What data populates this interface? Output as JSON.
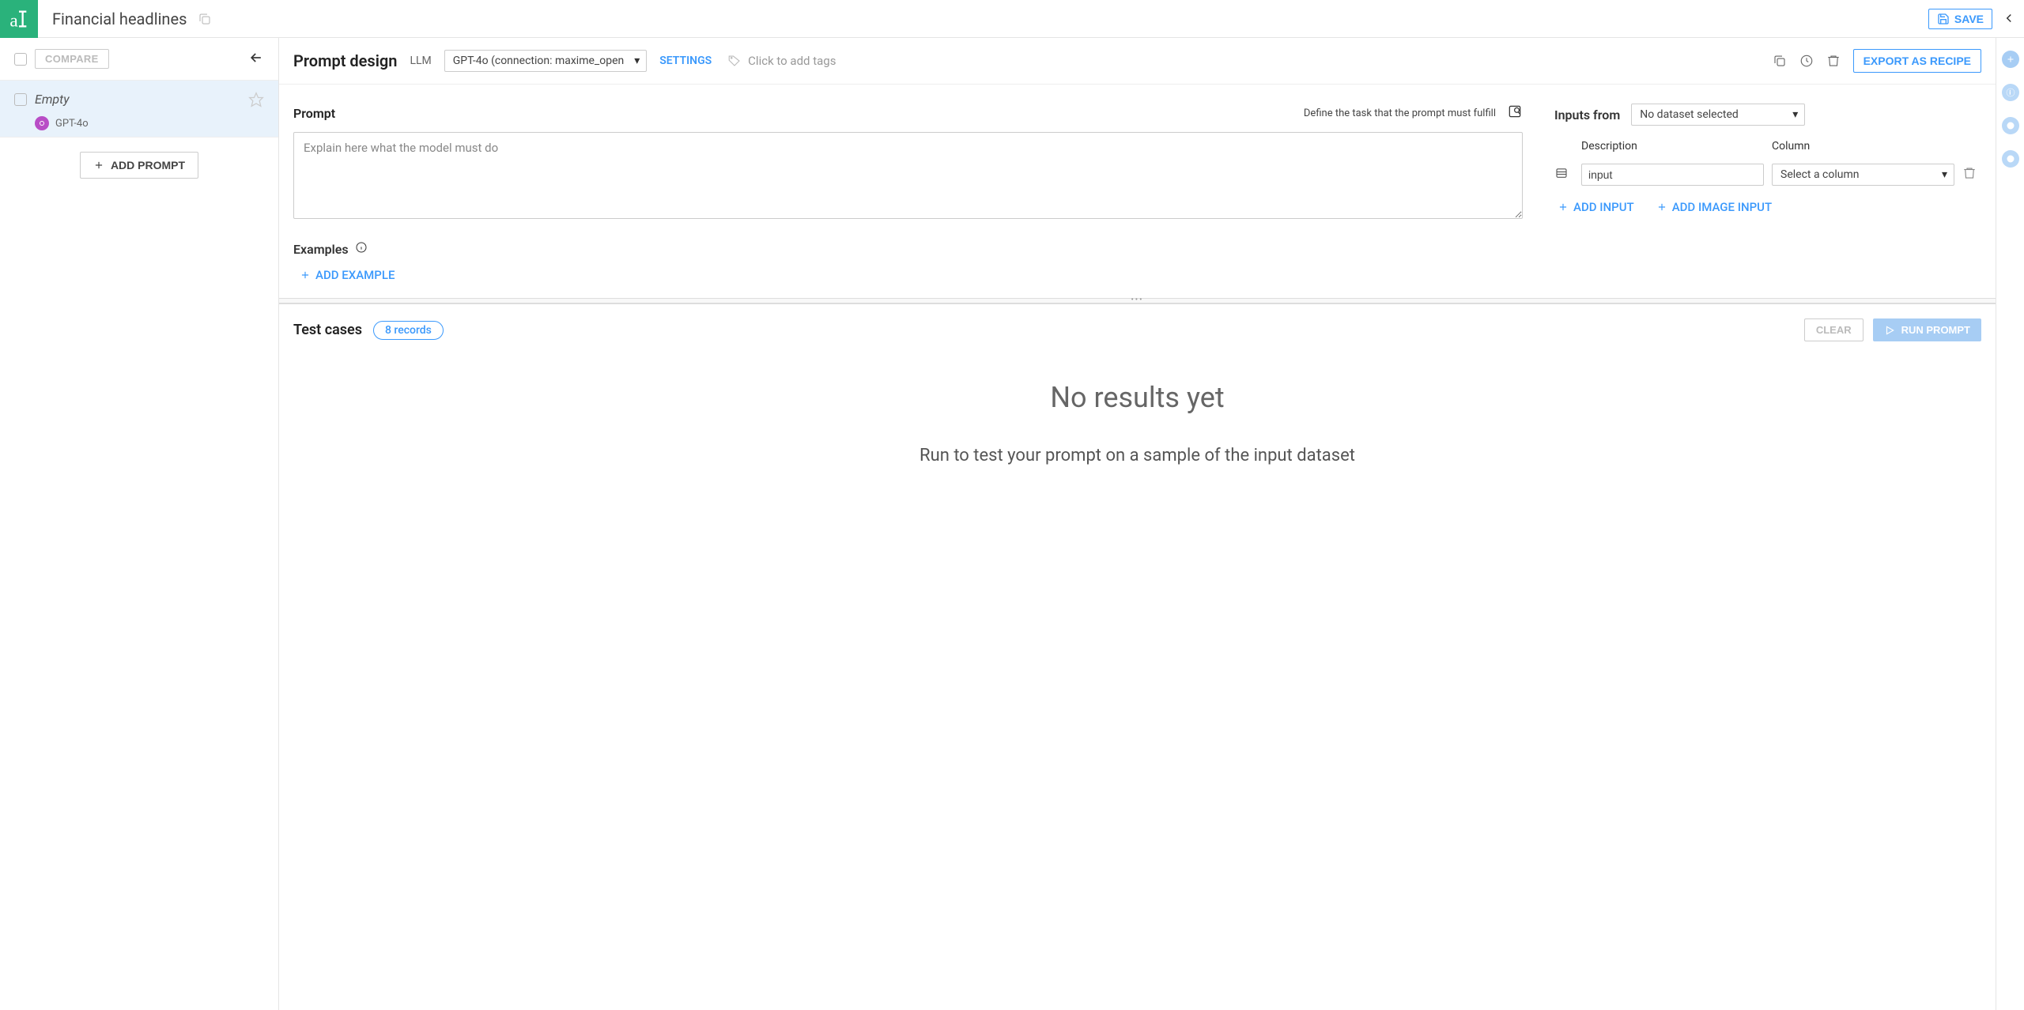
{
  "header": {
    "title": "Financial headlines",
    "save_label": "SAVE"
  },
  "sidebar": {
    "compare_label": "COMPARE",
    "prompt": {
      "title": "Empty",
      "model": "GPT-4o"
    },
    "add_prompt_label": "ADD PROMPT"
  },
  "main_header": {
    "title": "Prompt design",
    "llm_label": "LLM",
    "llm_value": "GPT-4o (connection: maxime_open",
    "settings_label": "SETTINGS",
    "tags_placeholder": "Click to add tags",
    "export_label": "EXPORT AS RECIPE"
  },
  "prompt_section": {
    "label": "Prompt",
    "hint": "Define the task that the prompt must fulfill",
    "placeholder": "Explain here what the model must do"
  },
  "examples": {
    "label": "Examples",
    "add_label": "ADD EXAMPLE"
  },
  "inputs": {
    "from_label": "Inputs from",
    "dataset_value": "No dataset selected",
    "col_desc": "Description",
    "col_col": "Column",
    "row_desc_value": "input",
    "row_col_value": "Select a column",
    "add_input_label": "ADD INPUT",
    "add_image_label": "ADD IMAGE INPUT"
  },
  "testcases": {
    "title": "Test cases",
    "records": "8 records",
    "clear_label": "CLEAR",
    "run_label": "RUN PROMPT",
    "empty_title": "No results yet",
    "empty_sub": "Run to test your prompt on a sample of the input dataset"
  }
}
